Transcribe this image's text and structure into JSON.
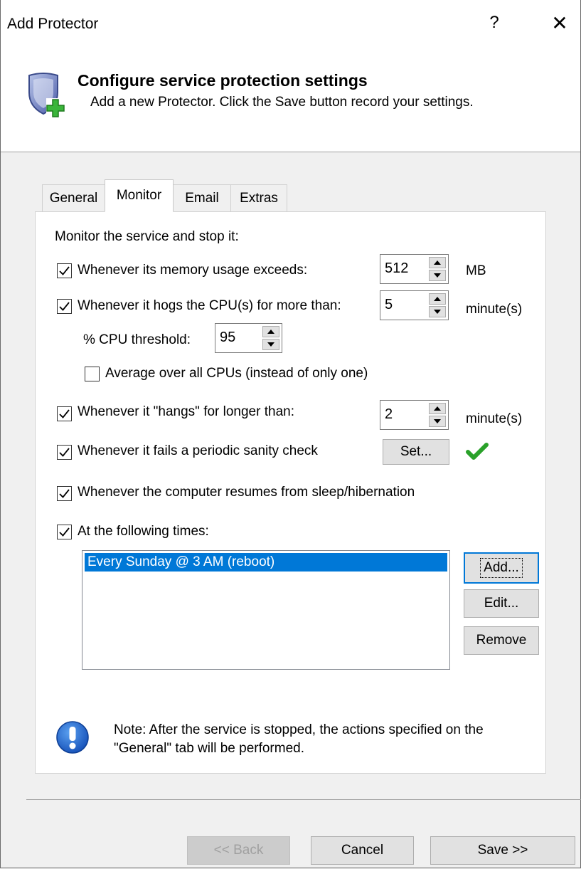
{
  "window": {
    "title": "Add Protector",
    "help_label": "?",
    "close_label": "✕"
  },
  "header": {
    "title": "Configure service protection settings",
    "subtitle": "Add a new Protector. Click the Save button record your settings.",
    "icon": "shield-add-icon"
  },
  "tabs": [
    {
      "label": "General",
      "active": false
    },
    {
      "label": "Monitor",
      "active": true
    },
    {
      "label": "Email",
      "active": false
    },
    {
      "label": "Extras",
      "active": false
    }
  ],
  "monitor": {
    "intro": "Monitor the service and stop it:",
    "memory": {
      "label": "Whenever its memory usage exceeds:",
      "checked": true,
      "value": "512",
      "unit": "MB"
    },
    "cpu": {
      "label": "Whenever it hogs the CPU(s) for more than:",
      "checked": true,
      "value": "5",
      "unit": "minute(s)"
    },
    "cpu_threshold": {
      "label": "% CPU threshold:",
      "value": "95"
    },
    "average": {
      "label": "Average over all CPUs (instead of only one)",
      "checked": false
    },
    "hangs": {
      "label": "Whenever it \"hangs\" for longer than:",
      "checked": true,
      "value": "2",
      "unit": "minute(s)"
    },
    "sanity": {
      "label": "Whenever it fails a periodic sanity check",
      "checked": true,
      "button": "Set...",
      "status_icon": "green-check-icon"
    },
    "resume": {
      "label": "Whenever the computer resumes from sleep/hibernation",
      "checked": true
    },
    "times": {
      "label": "At the following times:",
      "checked": true,
      "items": [
        "Every Sunday @ 3 AM (reboot)"
      ],
      "selected_index": 0,
      "add": "Add...",
      "edit": "Edit...",
      "remove": "Remove"
    },
    "note": {
      "icon": "info-exclamation-icon",
      "line1": "Note: After the service is stopped, the actions specified on the",
      "line2": "\"General\" tab will be performed."
    }
  },
  "footer": {
    "back": "<< Back",
    "cancel": "Cancel",
    "save": "Save >>"
  },
  "colors": {
    "accent": "#0078d7",
    "check_green": "#2aa12a",
    "info_blue": "#1c6fd6"
  }
}
